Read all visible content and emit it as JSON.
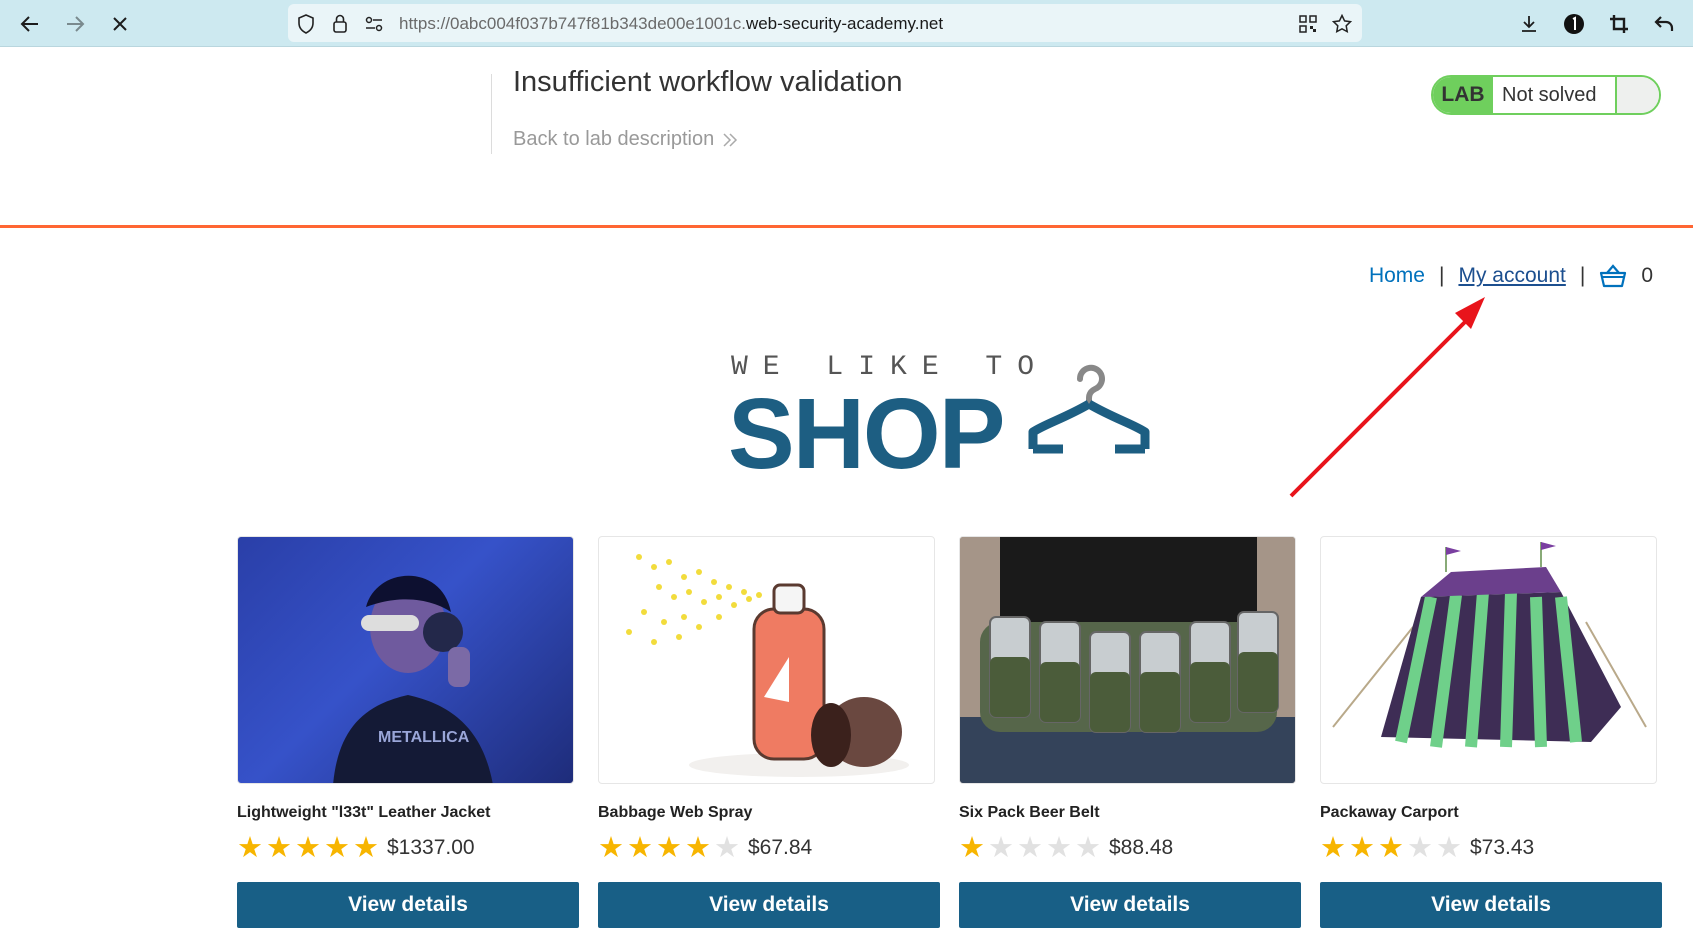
{
  "browser": {
    "url_prefix": "https://0abc004f037b747f81b343de00e1001c.",
    "url_host": "web-security-academy.net"
  },
  "lab": {
    "title": "Insufficient workflow validation",
    "back_link": "Back to lab description",
    "badge_label": "LAB",
    "status": "Not solved"
  },
  "nav": {
    "home": "Home",
    "separator": "|",
    "my_account": "My account",
    "cart_count": "0"
  },
  "logo": {
    "tagline": "WE LIKE TO",
    "word": "SHOP"
  },
  "products": [
    {
      "name": "Lightweight \"l33t\" Leather Jacket",
      "rating": 5,
      "price": "$1337.00",
      "button": "View details"
    },
    {
      "name": "Babbage Web Spray",
      "rating": 4,
      "price": "$67.84",
      "button": "View details"
    },
    {
      "name": "Six Pack Beer Belt",
      "rating": 1,
      "price": "$88.48",
      "button": "View details"
    },
    {
      "name": "Packaway Carport",
      "rating": 3,
      "price": "$73.43",
      "button": "View details"
    }
  ],
  "colors": {
    "accent_orange": "#ff6633",
    "button_blue": "#185f86",
    "lab_green": "#6fcf5d",
    "star": "#f7b500",
    "annotation_arrow": "#e8141b"
  }
}
